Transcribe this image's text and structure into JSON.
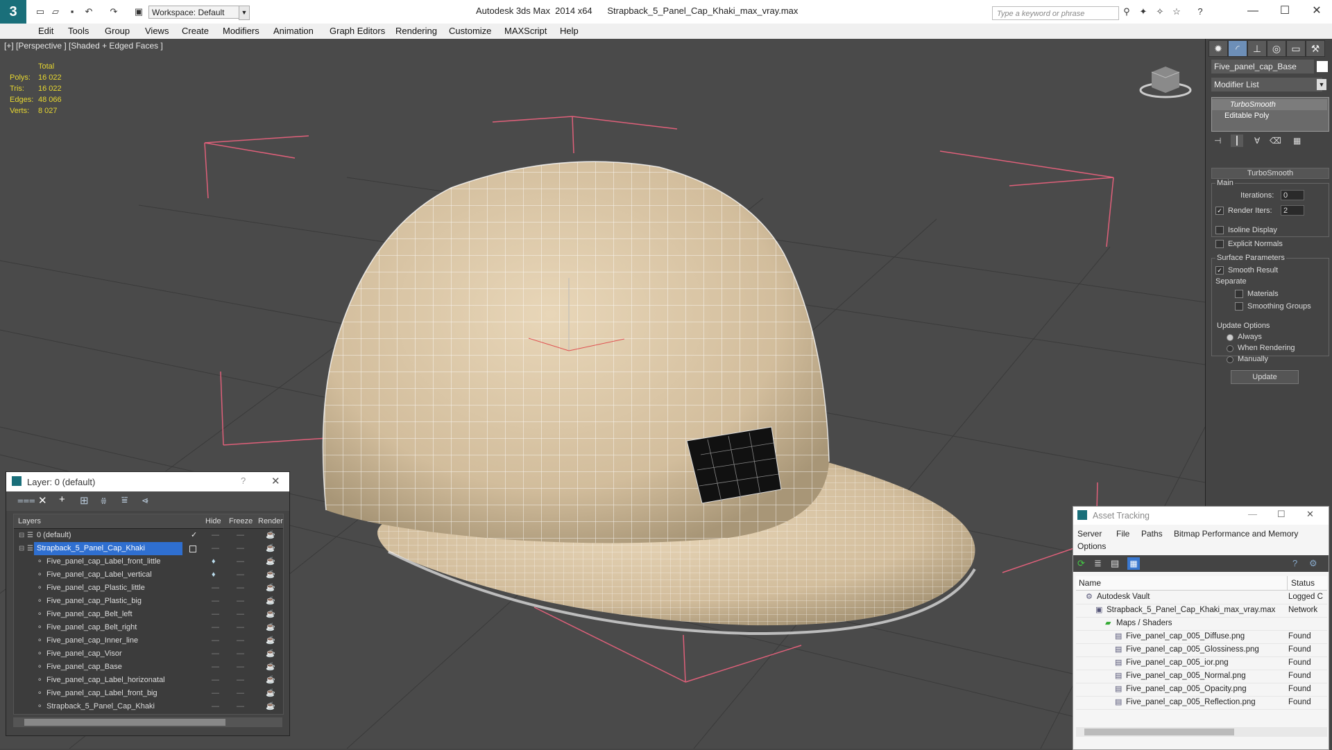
{
  "titlebar": {
    "title": "Autodesk 3ds Max  2014 x64      Strapback_5_Panel_Cap_Khaki_max_vray.max",
    "workspace": "Workspace: Default",
    "search_placeholder": "Type a keyword or phrase"
  },
  "menu": [
    "Edit",
    "Tools",
    "Group",
    "Views",
    "Create",
    "Modifiers",
    "Animation",
    "Graph Editors",
    "Rendering",
    "Customize",
    "MAXScript",
    "Help"
  ],
  "viewport": {
    "label": "[+] [Perspective ] [Shaded + Edged Faces ]",
    "stats_header": "Total",
    "stats": [
      {
        "label": "Polys:",
        "value": "16 022"
      },
      {
        "label": "Tris:",
        "value": "16 022"
      },
      {
        "label": "Edges:",
        "value": "48 066"
      },
      {
        "label": "Verts:",
        "value": "8 027"
      }
    ]
  },
  "command_panel": {
    "object_name": "Five_panel_cap_Base",
    "modifier_list": "Modifier List",
    "stack": [
      "TurboSmooth",
      "Editable Poly"
    ],
    "rollout_title": "TurboSmooth",
    "main_label": "Main",
    "iterations_label": "Iterations:",
    "iterations_value": "0",
    "render_iters_label": "Render Iters:",
    "render_iters_value": "2",
    "isoline": "Isoline Display",
    "explicit_normals": "Explicit Normals",
    "surface_params": "Surface Parameters",
    "smooth_result": "Smooth Result",
    "separate": "Separate",
    "materials": "Materials",
    "smoothing_groups": "Smoothing Groups",
    "update_options": "Update Options",
    "always": "Always",
    "when_rendering": "When Rendering",
    "manually": "Manually",
    "update_btn": "Update"
  },
  "layer_window": {
    "title": "Layer: 0 (default)",
    "columns": {
      "layers": "Layers",
      "hide": "Hide",
      "freeze": "Freeze",
      "render": "Render"
    },
    "rows": [
      "0 (default)",
      "Strapback_5_Panel_Cap_Khaki",
      "Five_panel_cap_Label_front_little",
      "Five_panel_cap_Label_vertical",
      "Five_panel_cap_Plastic_little",
      "Five_panel_cap_Plastic_big",
      "Five_panel_cap_Belt_left",
      "Five_panel_cap_Belt_right",
      "Five_panel_cap_Inner_line",
      "Five_panel_cap_Visor",
      "Five_panel_cap_Base",
      "Five_panel_cap_Label_horizonatal",
      "Five_panel_cap_Label_front_big",
      "Strapback_5_Panel_Cap_Khaki"
    ]
  },
  "asset_window": {
    "title": "Asset Tracking",
    "menu": [
      "Server",
      "File",
      "Paths",
      "Bitmap Performance and Memory"
    ],
    "menu2": "Options",
    "columns": {
      "name": "Name",
      "status": "Status"
    },
    "rows": [
      {
        "name": "Autodesk Vault",
        "status": "Logged C"
      },
      {
        "name": "Strapback_5_Panel_Cap_Khaki_max_vray.max",
        "status": "Network"
      },
      {
        "name": "Maps / Shaders",
        "status": ""
      },
      {
        "name": "Five_panel_cap_005_Diffuse.png",
        "status": "Found"
      },
      {
        "name": "Five_panel_cap_005_Glossiness.png",
        "status": "Found"
      },
      {
        "name": "Five_panel_cap_005_ior.png",
        "status": "Found"
      },
      {
        "name": "Five_panel_cap_005_Normal.png",
        "status": "Found"
      },
      {
        "name": "Five_panel_cap_005_Opacity.png",
        "status": "Found"
      },
      {
        "name": "Five_panel_cap_005_Reflection.png",
        "status": "Found"
      }
    ]
  },
  "colors": {
    "viewport_bg": "#4a4a4a",
    "cap": "#d8c4a4",
    "stats": "#e8d830",
    "selection": "#2f6fd0"
  }
}
